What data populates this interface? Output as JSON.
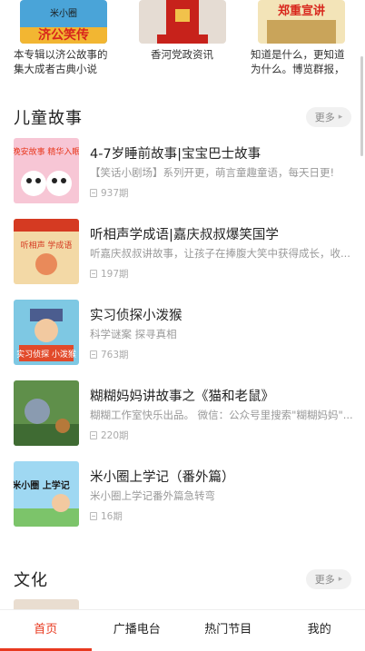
{
  "top_cards": [
    {
      "desc_line1": "本专辑以济公故事的",
      "desc_line2": "集大成者古典小说",
      "art_text": "济公笑传",
      "art_brand": "米小圈"
    },
    {
      "desc_line1": "香河党政资讯",
      "desc_line2": ""
    },
    {
      "desc_line1": "知道是什么，更知道",
      "desc_line2": "为什么。博览群报，",
      "art_text": "郑重宣讲"
    }
  ],
  "sections": {
    "kids": {
      "title": "儿童故事",
      "more": "更多"
    },
    "culture": {
      "title": "文化",
      "more": "更多"
    }
  },
  "items": [
    {
      "title": "4-7岁睡前故事|宝宝巴士故事",
      "desc": "【笑话小剧场】系列开更，萌言童趣童语，每天日更!",
      "count": "937期",
      "thumb_text": "晚安故事 精华入眠"
    },
    {
      "title": "听相声学成语|嘉庆叔叔爆笑国学",
      "desc": "听嘉庆叔叔讲故事，让孩子在捧腹大笑中获得成长，收...",
      "count": "197期",
      "thumb_text": "听相声 学成语"
    },
    {
      "title": "实习侦探小泼猴",
      "desc": "科学谜案 探寻真相",
      "count": "763期",
      "thumb_text": "实习侦探 小泼猴"
    },
    {
      "title": "糊糊妈妈讲故事之《猫和老鼠》",
      "desc": "糊糊工作室快乐出品。 微信：公众号里搜索\"糊糊妈妈\"...",
      "count": "220期"
    },
    {
      "title": "米小圈上学记（番外篇）",
      "desc": "米小圈上学记番外篇急转弯",
      "count": "16期",
      "thumb_text": "米小圈 上学记"
    }
  ],
  "nav": [
    {
      "label": "首页",
      "active": true
    },
    {
      "label": "广播电台",
      "active": false
    },
    {
      "label": "热门节目",
      "active": false
    },
    {
      "label": "我的",
      "active": false
    }
  ],
  "colors": {
    "accent": "#e8391f"
  }
}
